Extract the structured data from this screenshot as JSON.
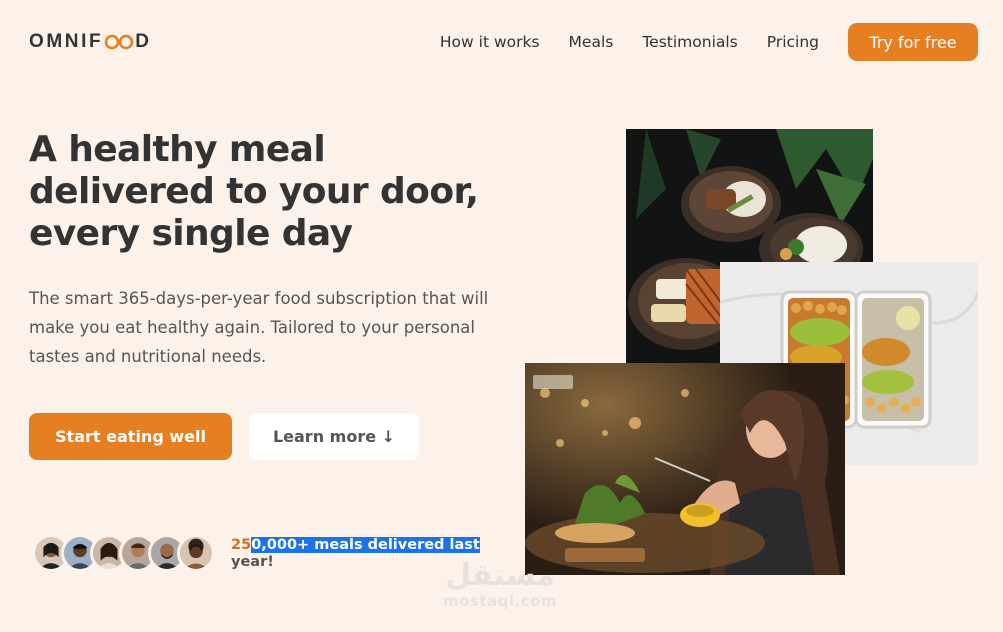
{
  "header": {
    "logo_left": "OMNIF",
    "logo_right": "D",
    "nav": [
      {
        "label": "How it works"
      },
      {
        "label": "Meals"
      },
      {
        "label": "Testimonials"
      },
      {
        "label": "Pricing"
      }
    ],
    "cta_label": "Try for free"
  },
  "hero": {
    "title": "A healthy meal delivered to your door, every single day",
    "description": "The smart 365-days-per-year food subscription that will make you eat healthy again. Tailored to your personal tastes and nutritional needs.",
    "primary_button": "Start eating well",
    "secondary_button": "Learn more ↓"
  },
  "delivered": {
    "num_part": "25",
    "highlight_part": "0,000+ meals delivered last",
    "rest_part": " year!"
  },
  "watermark": {
    "arabic": "مستقل",
    "latin": "mostaql.com"
  },
  "colors": {
    "background": "#fdf2e9",
    "accent": "#e67e22",
    "text": "#333333",
    "highlight": "#1a73e8"
  }
}
